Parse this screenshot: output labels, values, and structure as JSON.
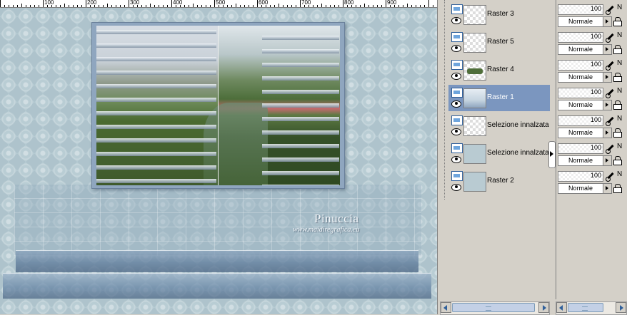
{
  "ruler": {
    "labels": [
      "100",
      "200",
      "300",
      "400",
      "500",
      "600",
      "700",
      "800",
      "900"
    ]
  },
  "canvas": {
    "watermark_name": "Pinuccia",
    "watermark_url": "www.maidiregrafica.eu"
  },
  "layers": [
    {
      "name": "Raster 3",
      "thumb": "checker",
      "selected": false
    },
    {
      "name": "Raster 5",
      "thumb": "checker",
      "selected": false
    },
    {
      "name": "Raster 4",
      "thumb": "green",
      "selected": false
    },
    {
      "name": "Raster 1",
      "thumb": "raster1",
      "selected": true
    },
    {
      "name": "Selezione innalzata",
      "thumb": "checker",
      "selected": false
    },
    {
      "name": "Selezione innalzata :",
      "thumb": "solid",
      "selected": false
    },
    {
      "name": "Raster 2",
      "thumb": "solid",
      "selected": false
    }
  ],
  "props": [
    {
      "opacity": "100",
      "blend": "Normale",
      "letter": "N"
    },
    {
      "opacity": "100",
      "blend": "Normale",
      "letter": "N"
    },
    {
      "opacity": "100",
      "blend": "Normale",
      "letter": "N"
    },
    {
      "opacity": "100",
      "blend": "Normale",
      "letter": "N"
    },
    {
      "opacity": "100",
      "blend": "Normale",
      "letter": "N"
    },
    {
      "opacity": "100",
      "blend": "Normale",
      "letter": "N"
    },
    {
      "opacity": "100",
      "blend": "Normale",
      "letter": "N"
    }
  ],
  "colors": {
    "selected_layer": "#7b96bf",
    "canvas_background": "#b9cdd4",
    "frame": "#8fa6bf"
  },
  "icons": [
    "visibility-toggle-icon",
    "eye-icon",
    "brush-icon",
    "lock-icon",
    "scroll-left-icon",
    "scroll-right-icon",
    "collapse-handle-icon"
  ]
}
